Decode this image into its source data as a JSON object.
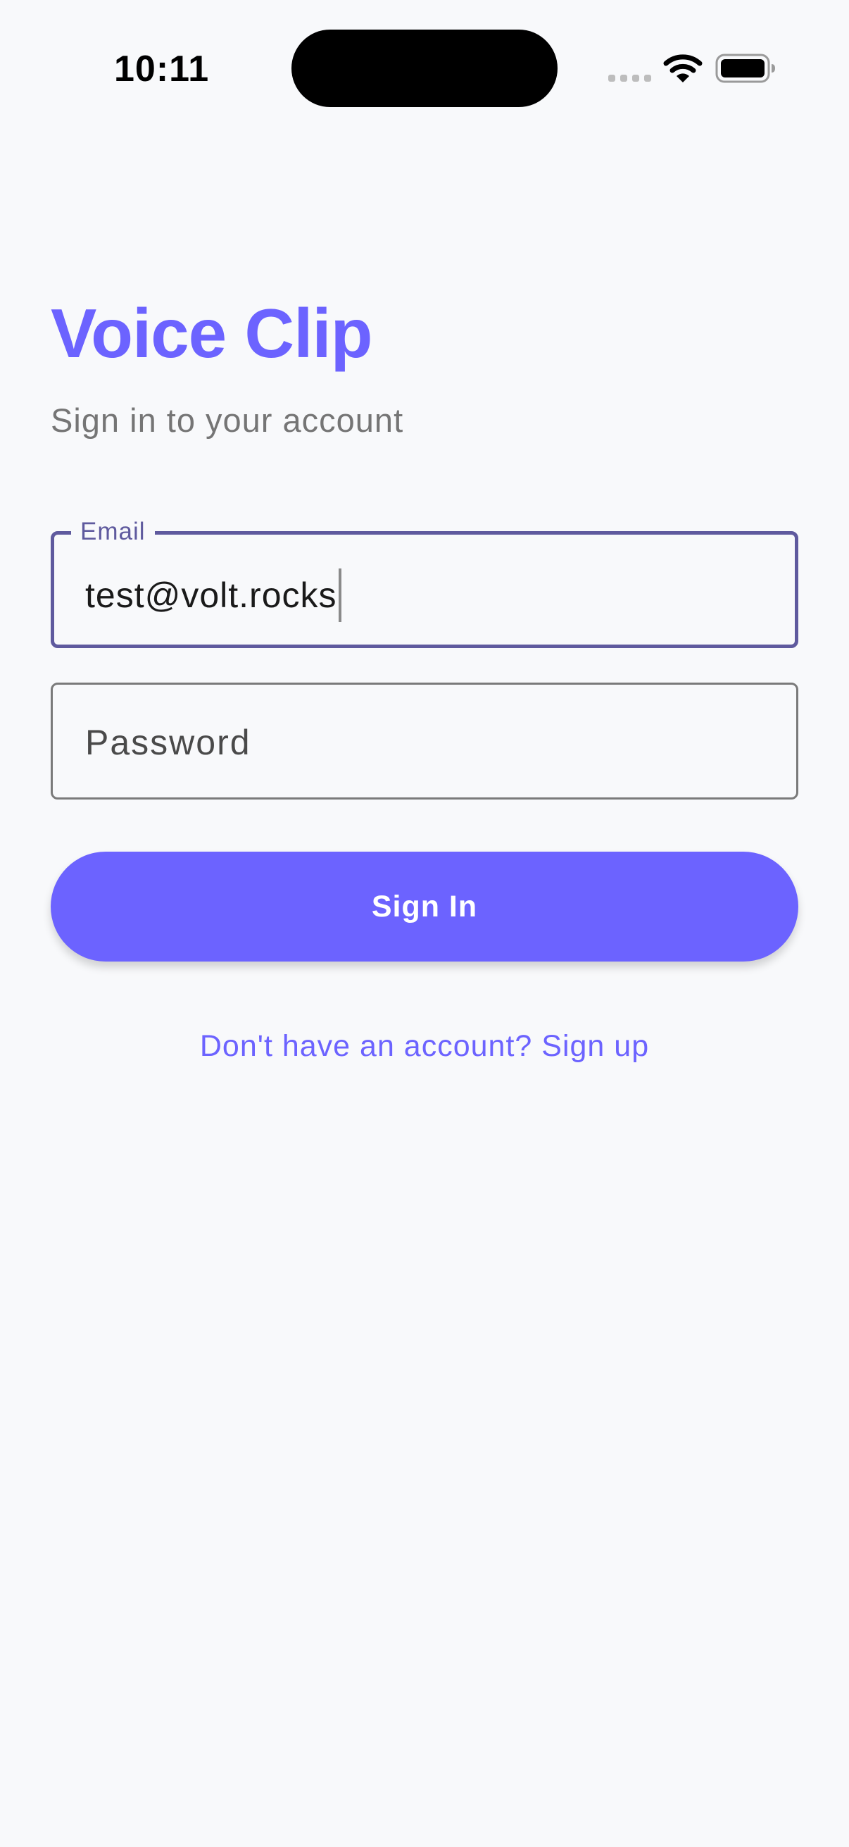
{
  "status_bar": {
    "time": "10:11"
  },
  "header": {
    "title": "Voice Clip",
    "subtitle": "Sign in to your account"
  },
  "form": {
    "email": {
      "label": "Email",
      "value": "test@volt.rocks"
    },
    "password": {
      "placeholder": "Password"
    },
    "submit_label": "Sign In",
    "signup_link": "Don't have an account? Sign up"
  },
  "colors": {
    "accent": "#6C63FF",
    "focused_outline": "#5F5A9E",
    "background": "#F8F9FB"
  },
  "icons": [
    "wifi-icon",
    "battery-icon",
    "cellular-signal-icon"
  ]
}
